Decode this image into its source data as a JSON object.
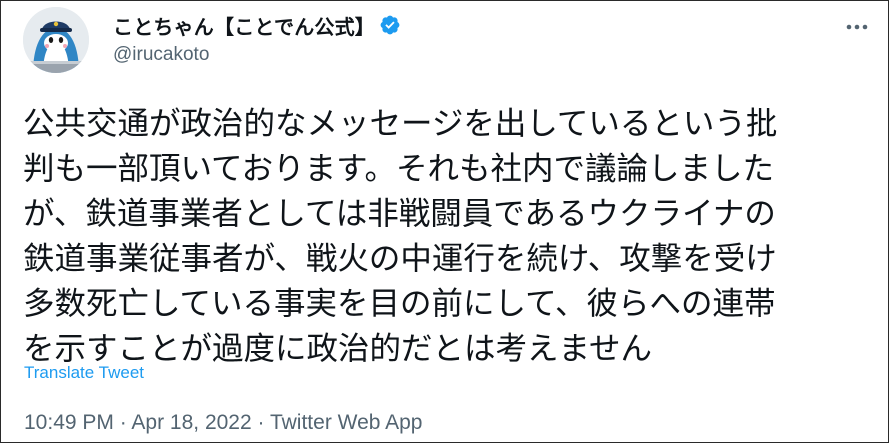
{
  "author": {
    "display_name": "ことちゃん【ことでん公式】",
    "handle": "@irucakoto",
    "verified_icon": "verified-badge-icon",
    "avatar_icon": "dolphin-mascot-avatar"
  },
  "menu": {
    "icon": "more-options-icon"
  },
  "tweet": {
    "text": "公共交通が政治的なメッセージを出しているという批\n判も一部頂いております。それも社内で議論しました\nが、鉄道事業者としては非戦闘員であるウクライナの\n鉄道事業従事者が、戦火の中運行を続け、攻撃を受け\n多数死亡している事実を目の前にして、彼らへの連帯\nを示すことが過度に政治的だとは考えません",
    "translate_label": "Translate Tweet"
  },
  "meta": {
    "time": "10:49 PM",
    "separator": " · ",
    "date": "Apr 18, 2022",
    "source": "Twitter Web App"
  },
  "colors": {
    "accent": "#1d9bf0",
    "text": "#0f1419",
    "secondary": "#536471"
  }
}
